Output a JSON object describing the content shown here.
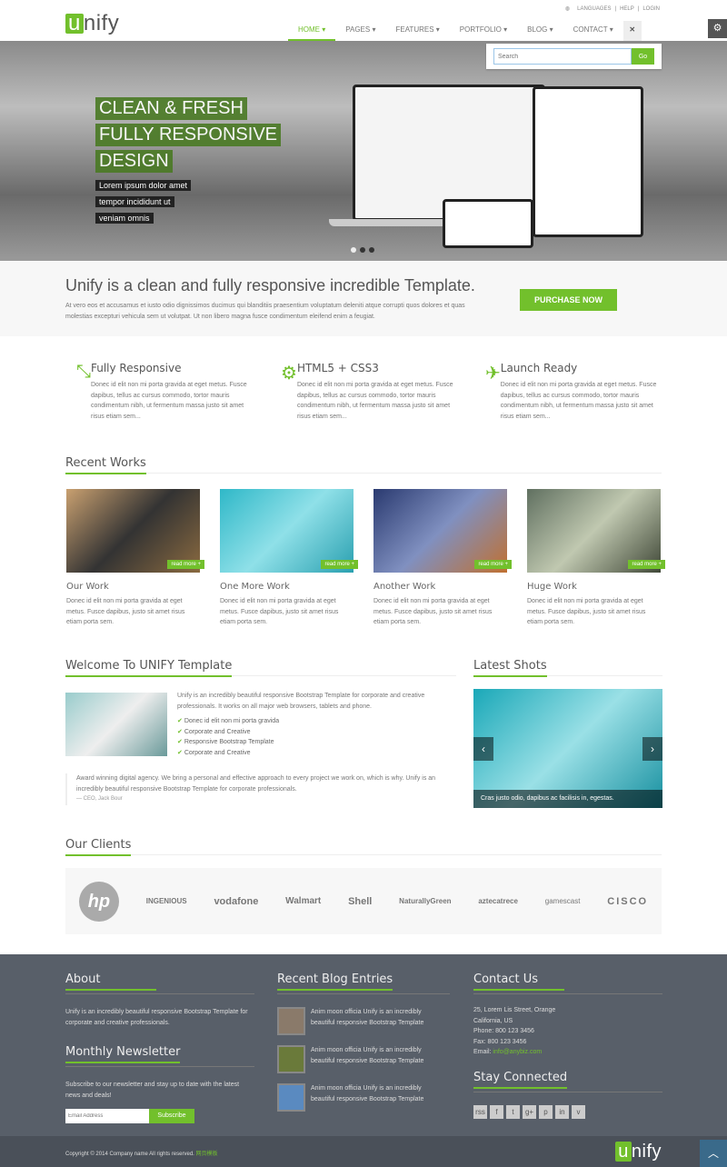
{
  "header": {
    "logo_letter": "u",
    "logo_rest": "nify",
    "top_links": [
      "LANGUAGES",
      "HELP",
      "LOGIN"
    ],
    "nav": [
      "HOME ▾",
      "PAGES ▾",
      "FEATURES ▾",
      "PORTFOLIO ▾",
      "BLOG ▾",
      "CONTACT ▾"
    ],
    "close": "✕",
    "search_placeholder": "Search",
    "search_button": "Go"
  },
  "slider": {
    "captions": [
      "CLEAN & FRESH",
      "FULLY RESPONSIVE",
      "DESIGN"
    ],
    "sub": [
      "Lorem ipsum dolor amet",
      "tempor incididunt ut",
      "veniam omnis"
    ],
    "slides": 3,
    "active_slide": 1
  },
  "purchase": {
    "title": "Unify is a clean and fully responsive incredible Template.",
    "text": "At vero eos et accusamus et iusto odio dignissimos ducimus qui blanditiis praesentium voluptatum deleniti atque corrupti quos dolores et quas molestias excepturi vehicula sem ut volutpat. Ut non libero magna fusce condimentum eleifend enim a feugiat.",
    "button": "PURCHASE NOW"
  },
  "services": [
    {
      "icon": "compress-icon",
      "glyph": "⤡",
      "title": "Fully Responsive",
      "text": "Donec id elit non mi porta gravida at eget metus. Fusce dapibus, tellus ac cursus commodo, tortor mauris condimentum nibh, ut fermentum massa justo sit amet risus etiam sem..."
    },
    {
      "icon": "cogs-icon",
      "glyph": "⚙",
      "title": "HTML5 + CSS3",
      "text": "Donec id elit non mi porta gravida at eget metus. Fusce dapibus, tellus ac cursus commodo, tortor mauris condimentum nibh, ut fermentum massa justo sit amet risus etiam sem..."
    },
    {
      "icon": "plane-icon",
      "glyph": "✈",
      "title": "Launch Ready",
      "text": "Donec id elit non mi porta gravida at eget metus. Fusce dapibus, tellus ac cursus commodo, tortor mauris condimentum nibh, ut fermentum massa justo sit amet risus etiam sem..."
    }
  ],
  "recent_works": {
    "heading": "Recent Works",
    "read_more": "read more +",
    "items": [
      {
        "title": "Our Work",
        "text": "Donec id elit non mi porta gravida at eget metus. Fusce dapibus, justo sit amet risus etiam porta sem."
      },
      {
        "title": "One More Work",
        "text": "Donec id elit non mi porta gravida at eget metus. Fusce dapibus, justo sit amet risus etiam porta sem."
      },
      {
        "title": "Another Work",
        "text": "Donec id elit non mi porta gravida at eget metus. Fusce dapibus, justo sit amet risus etiam porta sem."
      },
      {
        "title": "Huge Work",
        "text": "Donec id elit non mi porta gravida at eget metus. Fusce dapibus, justo sit amet risus etiam porta sem."
      }
    ]
  },
  "welcome": {
    "heading": "Welcome To UNIFY Template",
    "text": "Unify is an incredibly beautiful responsive Bootstrap Template for corporate and creative professionals. It works on all major web browsers, tablets and phone.",
    "list": [
      "Donec id elit non mi porta gravida",
      "Corporate and Creative",
      "Responsive Bootstrap Template",
      "Corporate and Creative"
    ],
    "quote": "Award winning digital agency. We bring a personal and effective approach to every project we work on, which is why. Unify is an incredibly beautiful responsive Bootstrap Template for corporate professionals.",
    "author": "— CEO, Jack Bour"
  },
  "latest_shots": {
    "heading": "Latest Shots",
    "caption": "Cras justo odio, dapibus ac facilisis in, egestas."
  },
  "clients": {
    "heading": "Our Clients",
    "logos": [
      "hp",
      "INGENIOUS",
      "vodafone",
      "Walmart",
      "Shell",
      "NaturallyGreen",
      "aztecatrece",
      "gamescast",
      "CISCO"
    ]
  },
  "footer": {
    "about_heading": "About",
    "about_text": "Unify is an incredibly beautiful responsive Bootstrap Template for corporate and creative professionals.",
    "newsletter_heading": "Monthly Newsletter",
    "newsletter_text": "Subscribe to our newsletter and stay up to date with the latest news and deals!",
    "email_placeholder": "Email Address",
    "subscribe": "Subscribe",
    "blog_heading": "Recent Blog Entries",
    "blog": [
      "Anim moon officia Unify is an incredibly beautiful responsive Bootstrap Template",
      "Anim moon officia Unify is an incredibly beautiful responsive Bootstrap Template",
      "Anim moon officia Unify is an incredibly beautiful responsive Bootstrap Template"
    ],
    "contact_heading": "Contact Us",
    "address1": "25, Lorem Lis Street, Orange",
    "address2": "California, US",
    "phone": "Phone: 800 123 3456",
    "fax": "Fax: 800 123 3456",
    "email_label": "Email: ",
    "email": "info@anybiz.com",
    "social_heading": "Stay Connected",
    "social": [
      "rss",
      "f",
      "t",
      "g+",
      "p",
      "in",
      "v"
    ],
    "copyright": "Copyright © 2014 Company name All rights reserved.",
    "copyright_link": "网页模板"
  },
  "colors": {
    "accent": "#72c02c",
    "footer": "#585f69"
  }
}
